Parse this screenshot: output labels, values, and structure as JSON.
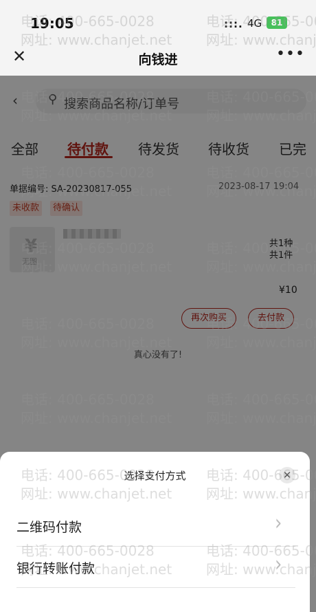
{
  "status_bar": {
    "time": "19:05",
    "signal": ":::.",
    "network": "4G",
    "battery": "81"
  },
  "title_bar": {
    "close": "✕",
    "title": "向钱进",
    "more": "•••"
  },
  "search": {
    "back": "‹",
    "icon": "search-icon",
    "placeholder": "搜索商品名称/订单号"
  },
  "tabs": [
    "全部",
    "待付款",
    "待发货",
    "待收货",
    "已完"
  ],
  "order": {
    "number": "单据编号: SA-20230817-055",
    "date": "2023-08-17 19:04",
    "tags": [
      "未收款",
      "待确认"
    ],
    "thumb_text": "无图",
    "qty_kinds": "共1种",
    "qty_items": "共1件",
    "price": "¥10",
    "buttons": [
      "再次购买",
      "去付款"
    ]
  },
  "end_text": "真心没有了!",
  "payment_sheet": {
    "title": "选择支付方式",
    "close": "✕",
    "options": [
      "二维码付款",
      "银行转账付款"
    ]
  },
  "watermark": {
    "phone": "电话: 400-665-0028",
    "site": "网址: www.chanjet.net"
  },
  "colors": {
    "accent": "#b8251c",
    "battery": "#46c15a",
    "tag_bg": "#fde5df"
  }
}
